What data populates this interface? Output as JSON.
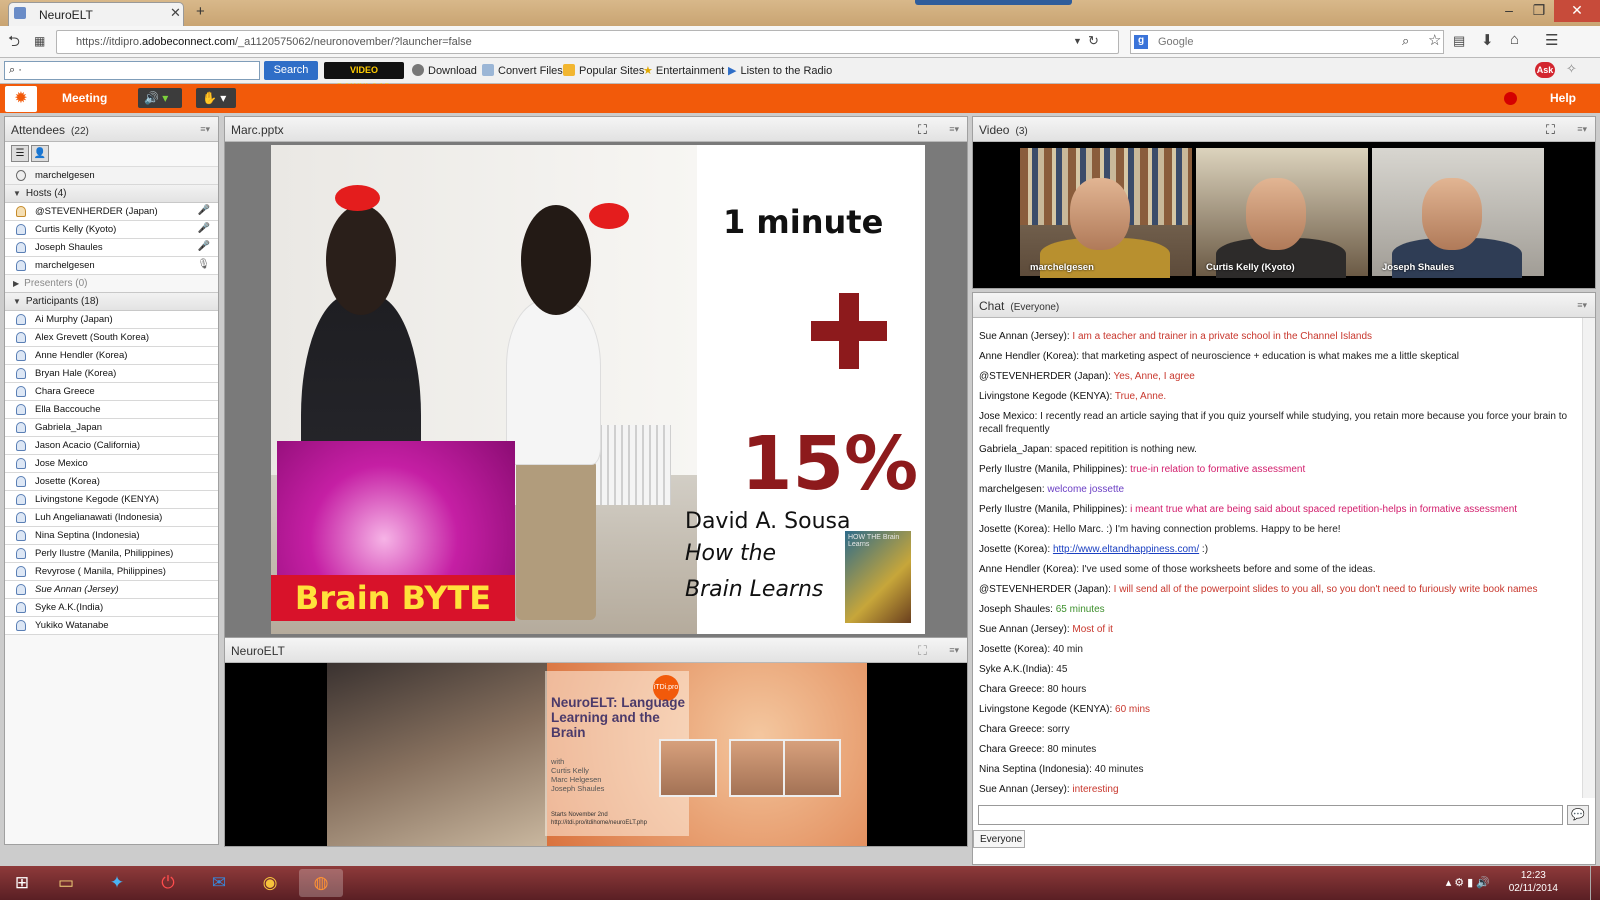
{
  "browser": {
    "tab_title": "NeuroELT",
    "url_prefix": "https://itdipro.",
    "url_domain": "adobeconnect.com",
    "url_path": "/_a1120575062/neuronovember/?launcher=false",
    "search_placeholder": "Google",
    "toolbar": {
      "search_button": "Search",
      "video_converter": "VIDEO DOWNLOAD CONVERTER",
      "items": [
        "Download",
        "Convert Files",
        "Popular Sites",
        "Entertainment",
        "Listen to the Radio"
      ],
      "ask_label": "Ask"
    }
  },
  "connect": {
    "meeting_menu": "Meeting",
    "help_menu": "Help"
  },
  "attendees": {
    "title": "Attendees",
    "count": "(22)",
    "self": "marchelgesen",
    "hosts_label": "Hosts (4)",
    "hosts": [
      "@STEVENHERDER (Japan)",
      "Curtis Kelly (Kyoto)",
      "Joseph Shaules",
      "marchelgesen"
    ],
    "presenters_label": "Presenters (0)",
    "participants_label": "Participants (18)",
    "participants": [
      "Ai Murphy (Japan)",
      "Alex Grevett (South Korea)",
      "Anne Hendler (Korea)",
      "Bryan Hale (Korea)",
      "Chara Greece",
      "Ella Baccouche",
      "Gabriela_Japan",
      "Jason Acacio (California)",
      "Jose Mexico",
      "Josette (Korea)",
      "Livingstone Kegode (KENYA)",
      "Luh Angelianawati (Indonesia)",
      "Nina Septina (Indonesia)",
      "Perly Ilustre (Manila, Philippines)",
      "Revyrose ( Manila, Philippines)",
      "Sue Annan (Jersey)",
      "Syke A.K.(India)",
      "Yukiko Watanabe"
    ]
  },
  "share": {
    "title": "Marc.pptx",
    "slide": {
      "brain_byte": "Brain BYTE",
      "minute": "1 minute",
      "percent": "15%",
      "author": "David A. Sousa",
      "book_line1": "How the",
      "book_line2": "Brain Learns",
      "cover_text": "HOW THE Brain Learns"
    }
  },
  "neuro_pod": {
    "title": "NeuroELT",
    "banner_title": "NeuroELT: Language Learning and the Brain",
    "banner_with": "with",
    "banner_names": [
      "Curtis Kelly",
      "Marc Helgesen",
      "Joseph Shaules"
    ],
    "banner_start": "Starts November 2nd",
    "banner_url": "http://itdi.pro/itdihome/neuroELT.php",
    "banner_logo": "iTDi.pro"
  },
  "video": {
    "title": "Video",
    "count": "(3)",
    "feeds": [
      "marchelgesen",
      "Curtis Kelly (Kyoto)",
      "Joseph Shaules"
    ]
  },
  "chat": {
    "title": "Chat",
    "scope": "(Everyone)",
    "tab": "Everyone",
    "messages": [
      {
        "who": "Sue Annan (Jersey):",
        "text": "I am a teacher and trainer in a private school in the Channel Islands",
        "color": "red"
      },
      {
        "who": "Anne Hendler (Korea):",
        "text": "that marketing aspect of neuroscience + education is what makes me a little skeptical",
        "color": "black"
      },
      {
        "who": "@STEVENHERDER (Japan):",
        "text": "Yes, Anne, I agree",
        "color": "red"
      },
      {
        "who": "Livingstone Kegode (KENYA):",
        "text": "True, Anne.",
        "color": "red"
      },
      {
        "who": "Jose Mexico:",
        "text": "I recently read an article saying that if you quiz yourself while studying, you retain more because you force your brain to recall frequently",
        "color": "black"
      },
      {
        "who": "Gabriela_Japan:",
        "text": "spaced repitition is nothing new.",
        "color": "black"
      },
      {
        "who": "Perly Ilustre (Manila, Philippines):",
        "text": "true-in relation to formative assessment",
        "color": "pink"
      },
      {
        "who": "marchelgesen:",
        "text": "welcome jossette",
        "color": "purple"
      },
      {
        "who": "Perly Ilustre (Manila, Philippines):",
        "text": "i meant true what are being said about spaced repetition-helps in formative assessment",
        "color": "pink"
      },
      {
        "who": "Josette (Korea):",
        "text": "Hello Marc. :) I'm having connection problems. Happy to be here!",
        "color": "black"
      },
      {
        "who": "Josette (Korea):",
        "text": "http://www.eltandhappiness.com/",
        "suffix": " :)",
        "color": "link"
      },
      {
        "who": "Anne Hendler (Korea):",
        "text": "I've used some of those worksheets before and some of the ideas.",
        "color": "black"
      },
      {
        "who": "@STEVENHERDER (Japan):",
        "text": "I will send all of the powerpoint slides to you all, so you don't need to furiously write book names",
        "color": "red"
      },
      {
        "who": "Joseph Shaules:",
        "text": "65 minutes",
        "color": "green"
      },
      {
        "who": "Sue Annan (Jersey):",
        "text": "Most of it",
        "color": "red"
      },
      {
        "who": "Josette (Korea):",
        "text": "40 min",
        "color": "black"
      },
      {
        "who": "Syke A.K.(India):",
        "text": "45",
        "color": "black"
      },
      {
        "who": "Chara Greece:",
        "text": "80 hours",
        "color": "black"
      },
      {
        "who": "Livingstone Kegode (KENYA):",
        "text": "60 mins",
        "color": "red"
      },
      {
        "who": "Chara Greece:",
        "text": "sorry",
        "color": "black"
      },
      {
        "who": "Chara Greece:",
        "text": "80 minutes",
        "color": "black"
      },
      {
        "who": "Nina Septina (Indonesia):",
        "text": "40 minutes",
        "color": "black"
      },
      {
        "who": "Sue Annan (Jersey):",
        "text": "interesting",
        "color": "red"
      }
    ]
  },
  "taskbar": {
    "time": "12:23",
    "date": "02/11/2014"
  },
  "colors": {
    "connect_orange": "#f25a0a",
    "slide_red": "#8d1a1c",
    "taskbar": "#6e2a2e"
  }
}
